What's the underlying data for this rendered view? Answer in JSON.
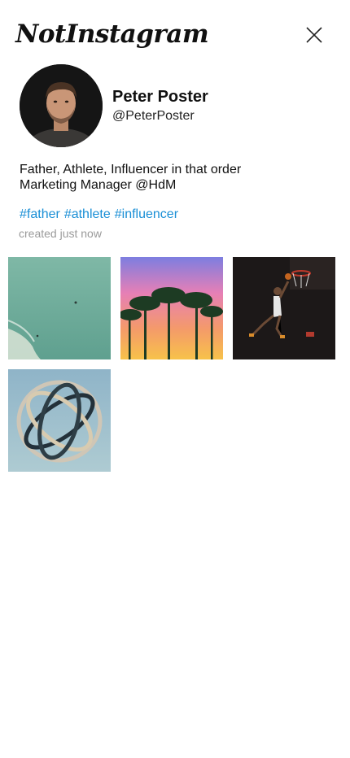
{
  "header": {
    "logo_text": "NotInstagram",
    "close_icon": "close-icon"
  },
  "profile": {
    "display_name": "Peter Poster",
    "handle": "@PeterPoster",
    "bio_lines": [
      "Father, Athlete, Influencer in that order",
      "Marketing Manager @HdM"
    ],
    "hashtags": [
      "#father",
      "#athlete",
      "#influencer"
    ],
    "created": "created just now"
  },
  "colors": {
    "hashtag": "#1a8fd6",
    "muted_text": "#9a9a9a"
  }
}
